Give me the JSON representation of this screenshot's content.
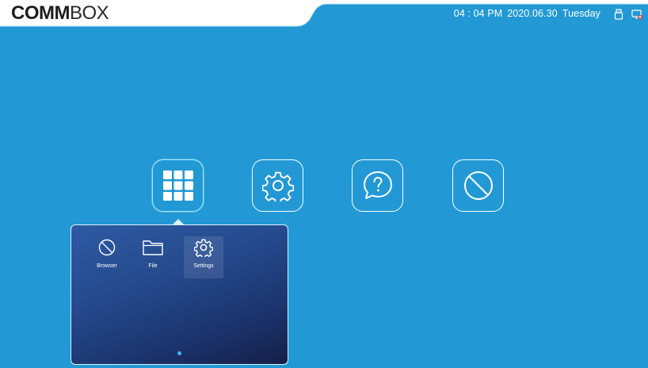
{
  "brand": {
    "logo_bold": "COMM",
    "logo_thin": "BOX"
  },
  "status_bar": {
    "time": "04 : 04 PM",
    "date": "2020.06.30",
    "weekday": "Tuesday",
    "icons": [
      "usb-icon",
      "screen-share-icon"
    ]
  },
  "dock": {
    "buttons": [
      {
        "name": "apps",
        "icon": "grid-icon",
        "active": true
      },
      {
        "name": "settings",
        "icon": "gear-icon",
        "active": false
      },
      {
        "name": "help",
        "icon": "help-bubble-icon",
        "active": false
      },
      {
        "name": "browser",
        "icon": "globe-icon",
        "active": false
      }
    ]
  },
  "popup": {
    "apps": [
      {
        "label": "Browser",
        "icon": "globe-icon"
      },
      {
        "label": "File",
        "icon": "folder-icon"
      },
      {
        "label": "Settings",
        "icon": "gear-icon"
      }
    ],
    "page_count": 1,
    "current_page": 1
  },
  "colors": {
    "background": "#2299d5",
    "popup_top": "#2e5aa3",
    "popup_bottom": "#141f47",
    "active_outline": "#9fe8f7",
    "page_dot": "#3fb4f5"
  }
}
